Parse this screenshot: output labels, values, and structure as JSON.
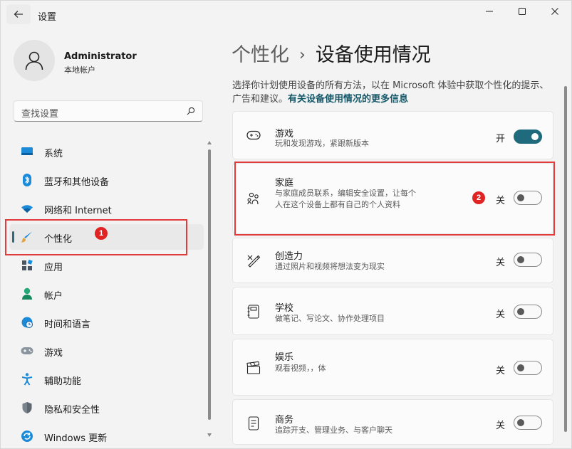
{
  "window": {
    "title": "设置"
  },
  "user": {
    "name": "Administrator",
    "account_type": "本地帐户"
  },
  "search": {
    "placeholder": "查找设置"
  },
  "sidebar": {
    "items": [
      {
        "label": "系统",
        "icon": "monitor-icon"
      },
      {
        "label": "蓝牙和其他设备",
        "icon": "bluetooth-icon"
      },
      {
        "label": "网络和 Internet",
        "icon": "wifi-icon"
      },
      {
        "label": "个性化",
        "icon": "brush-icon",
        "selected": true
      },
      {
        "label": "应用",
        "icon": "apps-icon"
      },
      {
        "label": "帐户",
        "icon": "person-icon"
      },
      {
        "label": "时间和语言",
        "icon": "globe-clock-icon"
      },
      {
        "label": "游戏",
        "icon": "gamepad-icon"
      },
      {
        "label": "辅助功能",
        "icon": "accessibility-icon"
      },
      {
        "label": "隐私和安全性",
        "icon": "shield-icon"
      },
      {
        "label": "Windows 更新",
        "icon": "update-icon"
      }
    ]
  },
  "breadcrumb": {
    "parent": "个性化",
    "separator": "›",
    "current": "设备使用情况"
  },
  "description": {
    "text": "选择你计划使用设备的所有方法，以在 Microsoft 体验中获取个性化的提示、广告和建议。",
    "link": "有关设备使用情况的更多信息"
  },
  "options": [
    {
      "title": "游戏",
      "subtitle": "玩和发现游戏，紧跟新版本",
      "state_label": "开",
      "on": true,
      "icon": "gamepad-icon"
    },
    {
      "title": "家庭",
      "subtitle": "与家庭成员联系，编辑安全设置，让每个人在这个设备上都有自己的个人资料",
      "state_label": "关",
      "on": false,
      "icon": "family-icon"
    },
    {
      "title": "创造力",
      "subtitle": "通过照片和视频将想法变为现实",
      "state_label": "关",
      "on": false,
      "icon": "creativity-icon"
    },
    {
      "title": "学校",
      "subtitle": "做笔记、写论文、协作处理项目",
      "state_label": "关",
      "on": false,
      "icon": "notebook-icon"
    },
    {
      "title": "娱乐",
      "subtitle": "观看视频，，体",
      "state_label": "关",
      "on": false,
      "icon": "clapperboard-icon"
    },
    {
      "title": "商务",
      "subtitle": "追踪开支、管理业务、与客户聊天",
      "state_label": "关",
      "on": false,
      "icon": "document-icon"
    }
  ],
  "annotations": {
    "badge_1": "1",
    "badge_2": "2"
  },
  "colors": {
    "accent": "#1f6a7c",
    "annotation_red": "#e23b3b"
  }
}
